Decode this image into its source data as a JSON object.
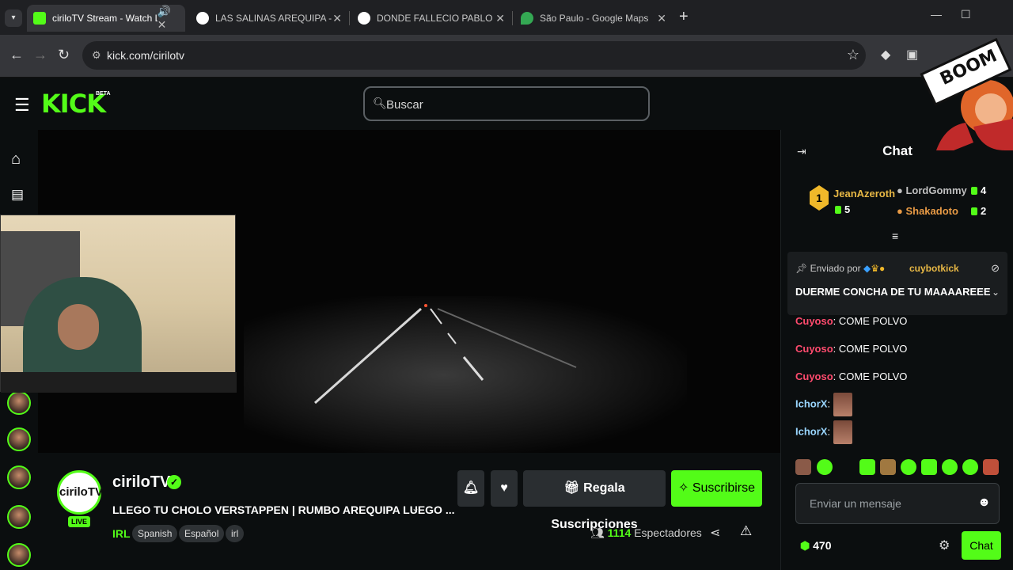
{
  "browser": {
    "tabs": [
      {
        "title": "ciriloTV Stream - Watch Live",
        "favicon": "kick-icon",
        "color": "#53fc18",
        "active": true
      },
      {
        "title": "LAS SALINAS AREQUIPA - Buscar",
        "favicon": "google-icon",
        "color": "#4285f4",
        "active": false
      },
      {
        "title": "DONDE FALLECIO PABLO VERGARA",
        "favicon": "google-icon",
        "color": "#4285f4",
        "active": false
      },
      {
        "title": "São Paulo - Google Maps",
        "favicon": "maps-icon",
        "color": "#34a853",
        "active": false
      }
    ],
    "url": "kick.com/cirilotv"
  },
  "site": {
    "logo": "KICK",
    "beta": "BETA",
    "search_placeholder": "Buscar"
  },
  "stream": {
    "channel": "ciriloTV",
    "avatar_text": "ciriloTV",
    "live": "LIVE",
    "title": "LLEGO TU CHOLO VERSTAPPEN | RUMBO AREQUIPA LUEGO ...",
    "category": "IRL",
    "tags": [
      "Spanish",
      "Español",
      "irl"
    ],
    "gift_button": "Regala Suscripciones",
    "subscribe_button": "Suscribirse",
    "viewers_count": "1114",
    "viewers_label": "Espectadores"
  },
  "chat": {
    "title": "Chat",
    "leaderboard": [
      {
        "rank": "1",
        "name": "JeanAzeroth",
        "count": "5",
        "color": "#e8b845"
      },
      {
        "name": "LordGommy",
        "count": "4",
        "color": "#c0c0c0"
      },
      {
        "name": "Shakadoto",
        "count": "2",
        "color": "#e89a45"
      }
    ],
    "pinned": {
      "sent_by": "Enviado por",
      "user": "cuybotkick",
      "message": "DUERME CONCHA DE TU MAAAAREEE"
    },
    "messages": [
      {
        "user": "Cuyoso",
        "text": "COME POLVO",
        "color": "#ff4b6e"
      },
      {
        "user": "Cuyoso",
        "text": "COME POLVO",
        "color": "#ff4b6e"
      },
      {
        "user": "Cuyoso",
        "text": "COME POLVO",
        "color": "#ff4b6e"
      },
      {
        "user": "IchorX",
        "text": "",
        "color": "#9ad6ff"
      },
      {
        "user": "IchorX",
        "text": "",
        "color": "#9ad6ff"
      }
    ],
    "input_placeholder": "Enviar un mensaje",
    "points": "470",
    "send_button": "Chat"
  },
  "overlay": {
    "text": "BOOM"
  }
}
